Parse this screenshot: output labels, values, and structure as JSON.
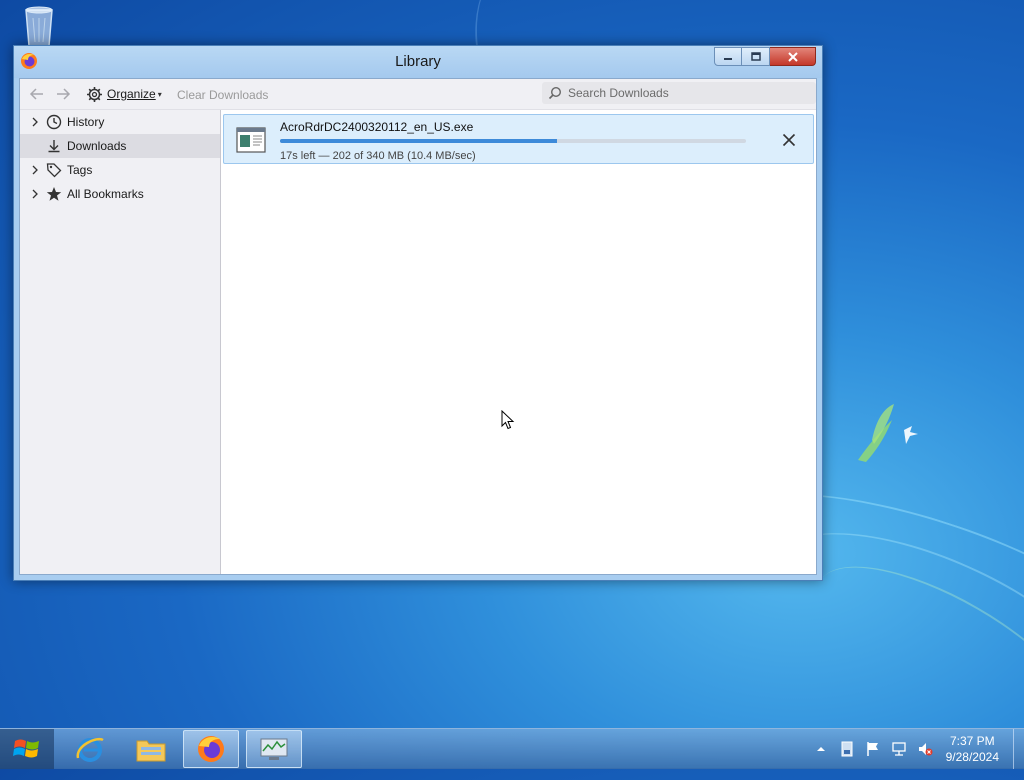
{
  "window": {
    "title": "Library"
  },
  "toolbar": {
    "organize_label": "Organize",
    "clear_downloads_label": "Clear Downloads",
    "search_placeholder": "Search Downloads"
  },
  "sidebar": {
    "items": [
      {
        "label": "History",
        "icon": "clock-icon",
        "expandable": true,
        "selected": false
      },
      {
        "label": "Downloads",
        "icon": "download-icon",
        "expandable": false,
        "selected": true
      },
      {
        "label": "Tags",
        "icon": "tag-icon",
        "expandable": true,
        "selected": false
      },
      {
        "label": "All Bookmarks",
        "icon": "star-icon",
        "expandable": true,
        "selected": false
      }
    ]
  },
  "downloads": [
    {
      "filename": "AcroRdrDC2400320112_en_US.exe",
      "status": "17s left — 202 of 340 MB (10.4 MB/sec)",
      "progress_fraction": 0.594
    }
  ],
  "taskbar": {
    "time": "7:37 PM",
    "date": "9/28/2024",
    "apps": [
      "internet-explorer-icon",
      "file-explorer-icon",
      "firefox-icon",
      "performance-monitor-icon"
    ]
  },
  "colors": {
    "accent": "#3d8ad9",
    "selected_row_bg": "#dceefc",
    "close_button": "#c4382a"
  }
}
